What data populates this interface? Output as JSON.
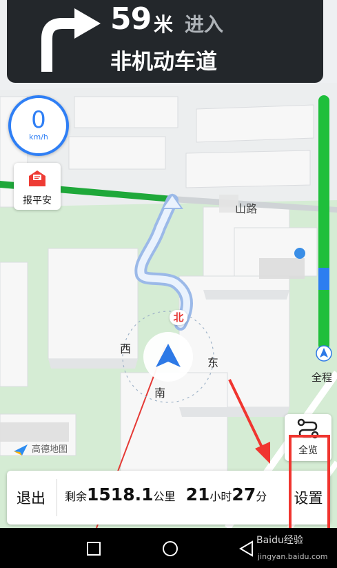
{
  "guidance": {
    "distance": "59",
    "unit": "米",
    "action": "进入",
    "road": "非机动车道",
    "turn_icon": "turn-right-arrow-icon"
  },
  "speedometer": {
    "value": "0",
    "unit": "km/h"
  },
  "report": {
    "label": "报平安",
    "icon": "envelope-icon"
  },
  "map": {
    "road_label": "山路",
    "compass": {
      "north": "北",
      "south": "南",
      "east": "东",
      "west": "西"
    },
    "logo": "高德地图"
  },
  "traffic_bar": {
    "full_route_label": "全程"
  },
  "overview": {
    "label": "全览",
    "icon": "route-icon"
  },
  "bottom_bar": {
    "exit": "退出",
    "remaining_prefix": "剩余",
    "distance": "1518.1",
    "distance_unit": "公里",
    "hours": "21",
    "hours_unit": "小时",
    "minutes": "27",
    "minutes_unit": "分",
    "settings": "设置"
  },
  "watermark": {
    "brand": "Baidu经验",
    "url": "jingyan.baidu.com"
  },
  "colors": {
    "accent": "#2f7ff5",
    "traffic_green": "#1fbf3b",
    "annotation": "#f0352f",
    "panel": "#23272b"
  }
}
